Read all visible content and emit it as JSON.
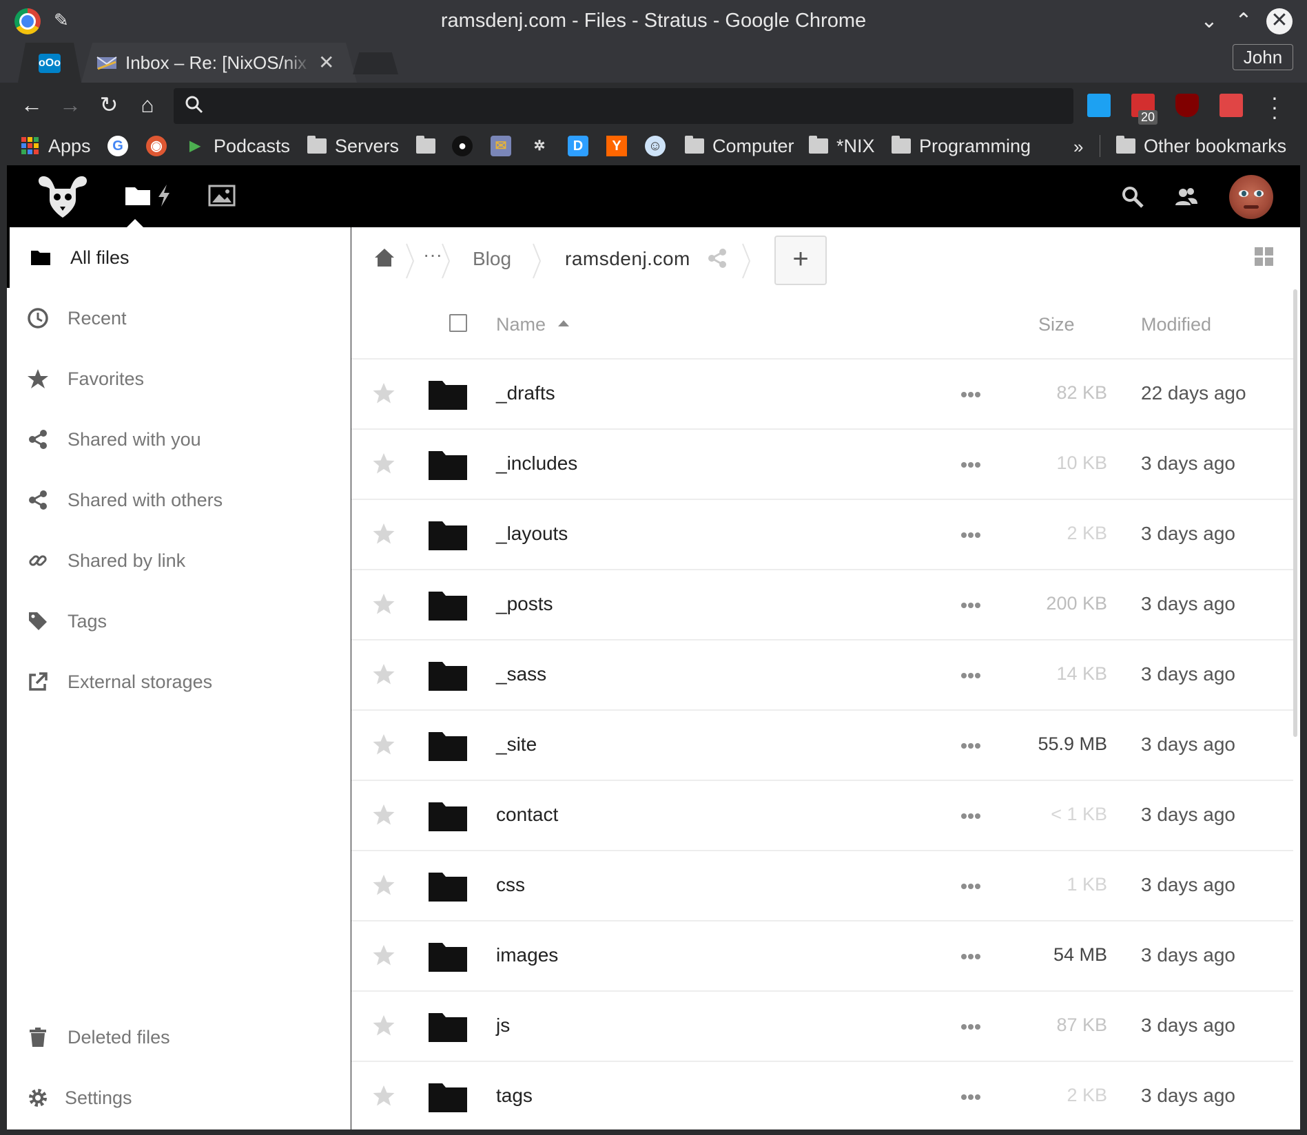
{
  "window": {
    "title": "ramsdenj.com - Files - Stratus - Google Chrome",
    "profile": "John"
  },
  "tabs": [
    {
      "icon": "nextcloud-icon",
      "title": "",
      "active": true
    },
    {
      "icon": "mail-icon",
      "title": "Inbox – Re: [NixOS/nix",
      "active": false
    }
  ],
  "toolbar": {
    "url": "",
    "extension_badge": "20"
  },
  "bookmarks": {
    "apps": "Apps",
    "podcasts": "Podcasts",
    "servers": "Servers",
    "computer": "Computer",
    "nix": "*NIX",
    "programming": "Programming",
    "more": "»",
    "other": "Other bookmarks"
  },
  "sidebar": {
    "items": [
      {
        "label": "All files",
        "icon": "folder-icon"
      },
      {
        "label": "Recent",
        "icon": "clock-icon"
      },
      {
        "label": "Favorites",
        "icon": "star-icon"
      },
      {
        "label": "Shared with you",
        "icon": "share-icon"
      },
      {
        "label": "Shared with others",
        "icon": "share-icon"
      },
      {
        "label": "Shared by link",
        "icon": "link-icon"
      },
      {
        "label": "Tags",
        "icon": "tag-icon"
      },
      {
        "label": "External storages",
        "icon": "external-icon"
      }
    ],
    "deleted": "Deleted files",
    "settings": "Settings"
  },
  "breadcrumb": {
    "ellipsis": "···",
    "blog": "Blog",
    "current": "ramsdenj.com",
    "new_button": "+"
  },
  "table": {
    "col_name": "Name",
    "col_size": "Size",
    "col_modified": "Modified",
    "rows": [
      {
        "name": "_drafts",
        "size": "82 KB",
        "modified": "22 days ago",
        "size_color": "#c4c4c4"
      },
      {
        "name": "_includes",
        "size": "10 KB",
        "modified": "3 days ago",
        "size_color": "#cfcfcf"
      },
      {
        "name": "_layouts",
        "size": "2 KB",
        "modified": "3 days ago",
        "size_color": "#d4d4d4"
      },
      {
        "name": "_posts",
        "size": "200 KB",
        "modified": "3 days ago",
        "size_color": "#bdbdbd"
      },
      {
        "name": "_sass",
        "size": "14 KB",
        "modified": "3 days ago",
        "size_color": "#cccccc"
      },
      {
        "name": "_site",
        "size": "55.9 MB",
        "modified": "3 days ago",
        "size_color": "#444444"
      },
      {
        "name": "contact",
        "size": "< 1 KB",
        "modified": "3 days ago",
        "size_color": "#d6d6d6"
      },
      {
        "name": "css",
        "size": "1 KB",
        "modified": "3 days ago",
        "size_color": "#d4d4d4"
      },
      {
        "name": "images",
        "size": "54 MB",
        "modified": "3 days ago",
        "size_color": "#444444"
      },
      {
        "name": "js",
        "size": "87 KB",
        "modified": "3 days ago",
        "size_color": "#c4c4c4"
      },
      {
        "name": "tags",
        "size": "2 KB",
        "modified": "3 days ago",
        "size_color": "#d4d4d4"
      }
    ]
  }
}
